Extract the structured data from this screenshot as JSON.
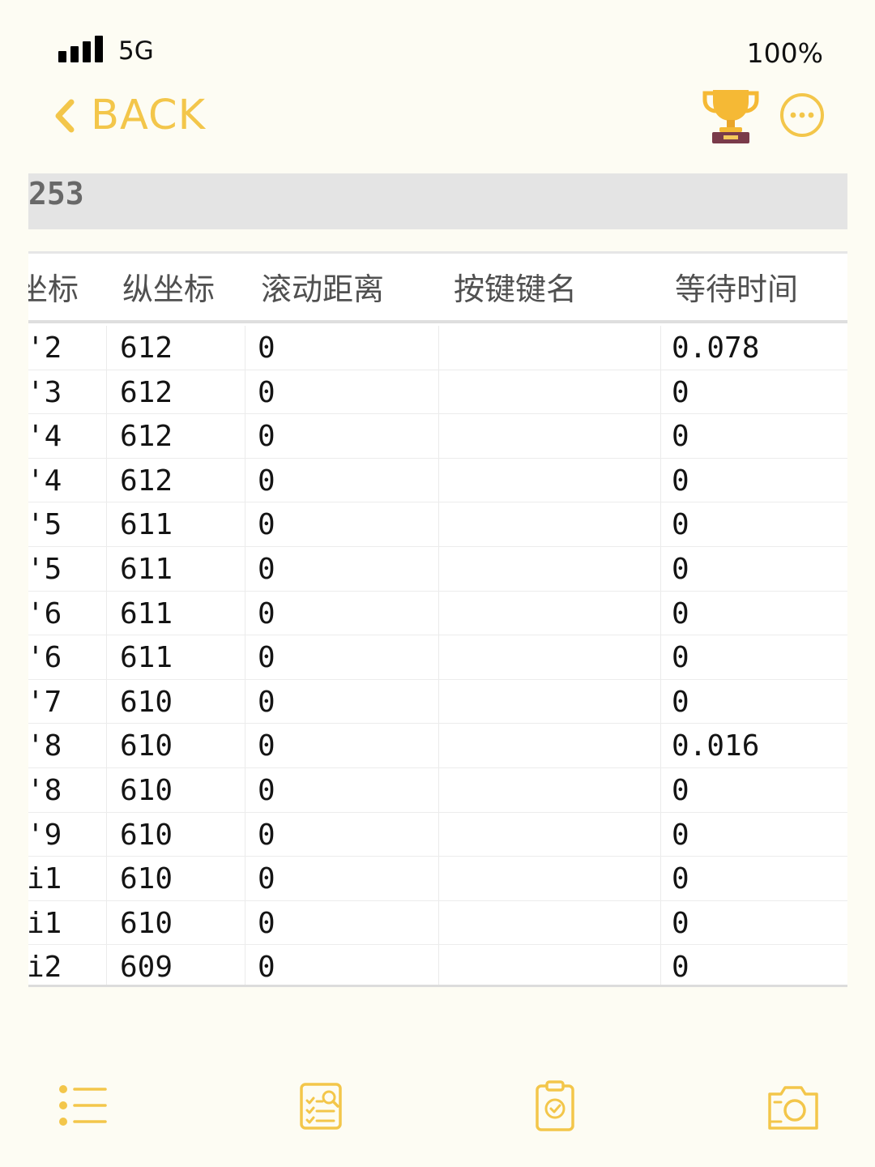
{
  "status_bar": {
    "network": "5G",
    "battery": "100%"
  },
  "nav": {
    "back_label": "BACK",
    "icons": [
      "chevron-left-icon",
      "trophy-icon",
      "more-icon"
    ],
    "accent_color": "#f3c64a"
  },
  "content": {
    "band_text": "253",
    "table": {
      "headers": [
        "坐标",
        "纵坐标",
        "滚动距离",
        "按键键名",
        "等待时间"
      ],
      "rows": [
        {
          "c1": "'2",
          "c2": "612",
          "c3": "0",
          "c4": "",
          "c5": "0.078"
        },
        {
          "c1": "'3",
          "c2": "612",
          "c3": "0",
          "c4": "",
          "c5": "0"
        },
        {
          "c1": "'4",
          "c2": "612",
          "c3": "0",
          "c4": "",
          "c5": "0"
        },
        {
          "c1": "'4",
          "c2": "612",
          "c3": "0",
          "c4": "",
          "c5": "0"
        },
        {
          "c1": "'5",
          "c2": "611",
          "c3": "0",
          "c4": "",
          "c5": "0"
        },
        {
          "c1": "'5",
          "c2": "611",
          "c3": "0",
          "c4": "",
          "c5": "0"
        },
        {
          "c1": "'6",
          "c2": "611",
          "c3": "0",
          "c4": "",
          "c5": "0"
        },
        {
          "c1": "'6",
          "c2": "611",
          "c3": "0",
          "c4": "",
          "c5": "0"
        },
        {
          "c1": "'7",
          "c2": "610",
          "c3": "0",
          "c4": "",
          "c5": "0"
        },
        {
          "c1": "'8",
          "c2": "610",
          "c3": "0",
          "c4": "",
          "c5": "0.016"
        },
        {
          "c1": "'8",
          "c2": "610",
          "c3": "0",
          "c4": "",
          "c5": "0"
        },
        {
          "c1": "'9",
          "c2": "610",
          "c3": "0",
          "c4": "",
          "c5": "0"
        },
        {
          "c1": "i1",
          "c2": "610",
          "c3": "0",
          "c4": "",
          "c5": "0"
        },
        {
          "c1": "i1",
          "c2": "610",
          "c3": "0",
          "c4": "",
          "c5": "0"
        },
        {
          "c1": "i2",
          "c2": "609",
          "c3": "0",
          "c4": "",
          "c5": "0"
        }
      ]
    }
  },
  "toolbar": {
    "icons": [
      "list-icon",
      "search-checklist-icon",
      "clipboard-check-icon",
      "camera-icon"
    ]
  }
}
